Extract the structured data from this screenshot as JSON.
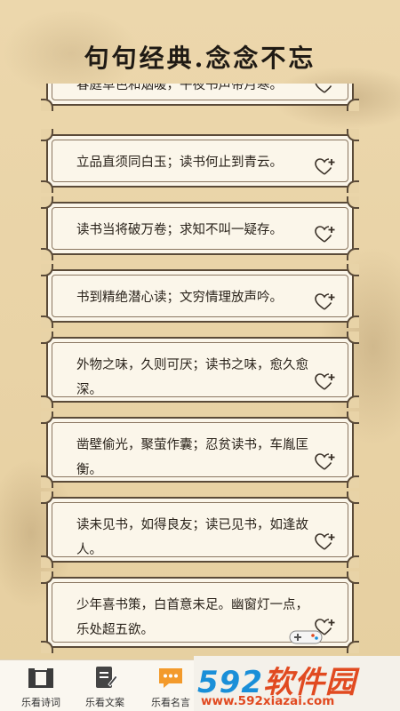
{
  "header": {
    "title": "句句经典.念念不忘"
  },
  "quotes": [
    {
      "text": "春庭草色和烟暖，午夜书声带月寒。"
    },
    {
      "text": "立品直须同白玉；读书何止到青云。"
    },
    {
      "text": "读书当将破万卷；求知不叫一疑存。"
    },
    {
      "text": "书到精绝潜心读；文穷情理放声吟。"
    },
    {
      "text": "外物之味，久则可厌；读书之味，愈久愈深。"
    },
    {
      "text": "凿壁偷光，聚萤作囊；忍贫读书，车胤匡衡。"
    },
    {
      "text": "读未见书，如得良友；读已见书，如逢故人。"
    },
    {
      "text": "少年喜书策，白首意未足。幽窗灯一点，乐处超五欲。"
    }
  ],
  "tabbar": {
    "tabs": [
      {
        "label": "乐看诗词",
        "icon": "book-stand-icon"
      },
      {
        "label": "乐看文案",
        "icon": "document-pen-icon"
      },
      {
        "label": "乐看名言",
        "icon": "chat-bubble-icon",
        "active": true
      }
    ]
  },
  "watermark": {
    "brand_num": "592",
    "brand_text": "软件园",
    "url": "www.592xiazai.com"
  },
  "colors": {
    "background": "#e9d4a8",
    "card": "#fbf6ea",
    "border": "#5a4a38",
    "active_tab": "#f39a2b",
    "watermark_red": "#e14a20",
    "watermark_blue": "#1a8fd8"
  }
}
